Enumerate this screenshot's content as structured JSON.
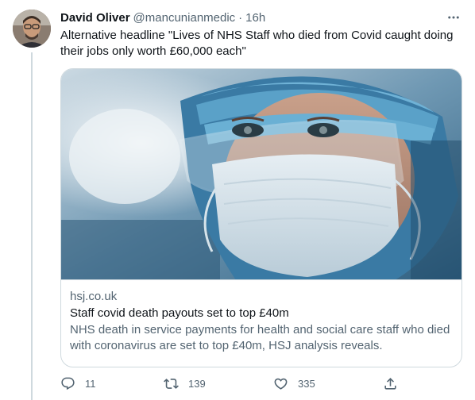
{
  "tweet": {
    "author_name": "David Oliver",
    "handle": "@mancunianmedic",
    "separator": "·",
    "time": "16h",
    "text": "Alternative headline \"Lives of NHS Staff who died from Covid caught doing their jobs only worth £60,000 each\""
  },
  "card": {
    "domain": "hsj.co.uk",
    "title": "Staff covid death payouts set to top £40m",
    "description": "NHS death in service payments for health and social care staff who died with coronavirus are set to top £40m, HSJ analysis reveals."
  },
  "actions": {
    "reply_count": "11",
    "retweet_count": "139",
    "like_count": "335"
  },
  "icons": {
    "more": "more-icon",
    "reply": "reply-icon",
    "retweet": "retweet-icon",
    "like": "like-icon",
    "share": "share-icon"
  },
  "colors": {
    "text_primary": "#0f1419",
    "text_secondary": "#536471",
    "border": "#cfd9de",
    "scrub_cap": "#5b9fc4"
  }
}
